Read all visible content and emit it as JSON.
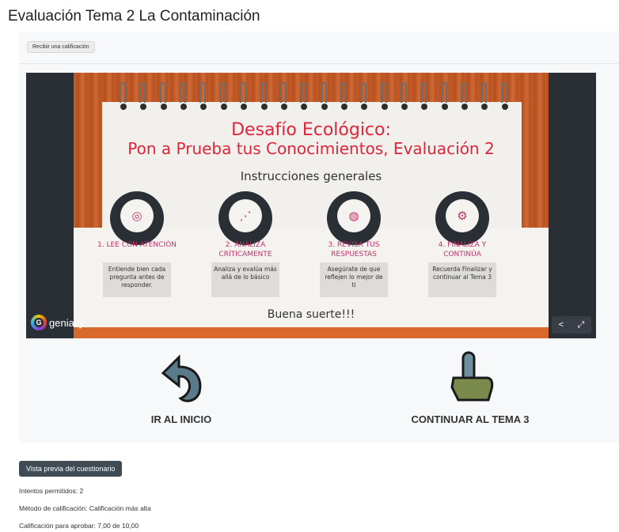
{
  "page": {
    "title": "Evaluación Tema 2 La Contaminación"
  },
  "completion": {
    "label": "Recibir una calificación"
  },
  "embed": {
    "title_line1": "Desafío Ecológico:",
    "title_line2": "Pon a Prueba tus Conocimientos, Evaluación 2",
    "subtitle": "Instrucciones generales",
    "steps": [
      {
        "heading": "1. LEE CON ATENCIÓN",
        "text": "Entiende bien cada pregunta antes de responder.",
        "icon": "fingerprint-icon"
      },
      {
        "heading": "2. ANALIZA CRÍTICAMENTE",
        "text": "Analiza y evalúa más allá de lo básico",
        "icon": "chart-icon"
      },
      {
        "heading": "3. REVISA TUS RESPUESTAS",
        "text": "Asegúrate de que reflejen lo mejor de ti",
        "icon": "globe-icon"
      },
      {
        "heading": "4. FINALIZA Y CONTINÚA",
        "text": "Recuerda Finalizar y continuar al Tema 3",
        "icon": "gears-icon"
      }
    ],
    "closing": "Buena suerte!!!",
    "brand": "genially",
    "colors": {
      "accent": "#e0253a",
      "step_color": "#c2306c",
      "wood": "#c45c2a",
      "dark": "#2a2e35"
    }
  },
  "nav": {
    "home_label": "IR AL INICIO",
    "next_label": "CONTINUAR AL TEMA 3"
  },
  "quiz": {
    "preview_button": "Vista previa del cuestionario",
    "attempts": "Intentos permitidos: 2",
    "method": "Método de calificación: Calificación más alta",
    "pass_grade": "Calificación para aprobar: 7,00 de 10,00"
  }
}
